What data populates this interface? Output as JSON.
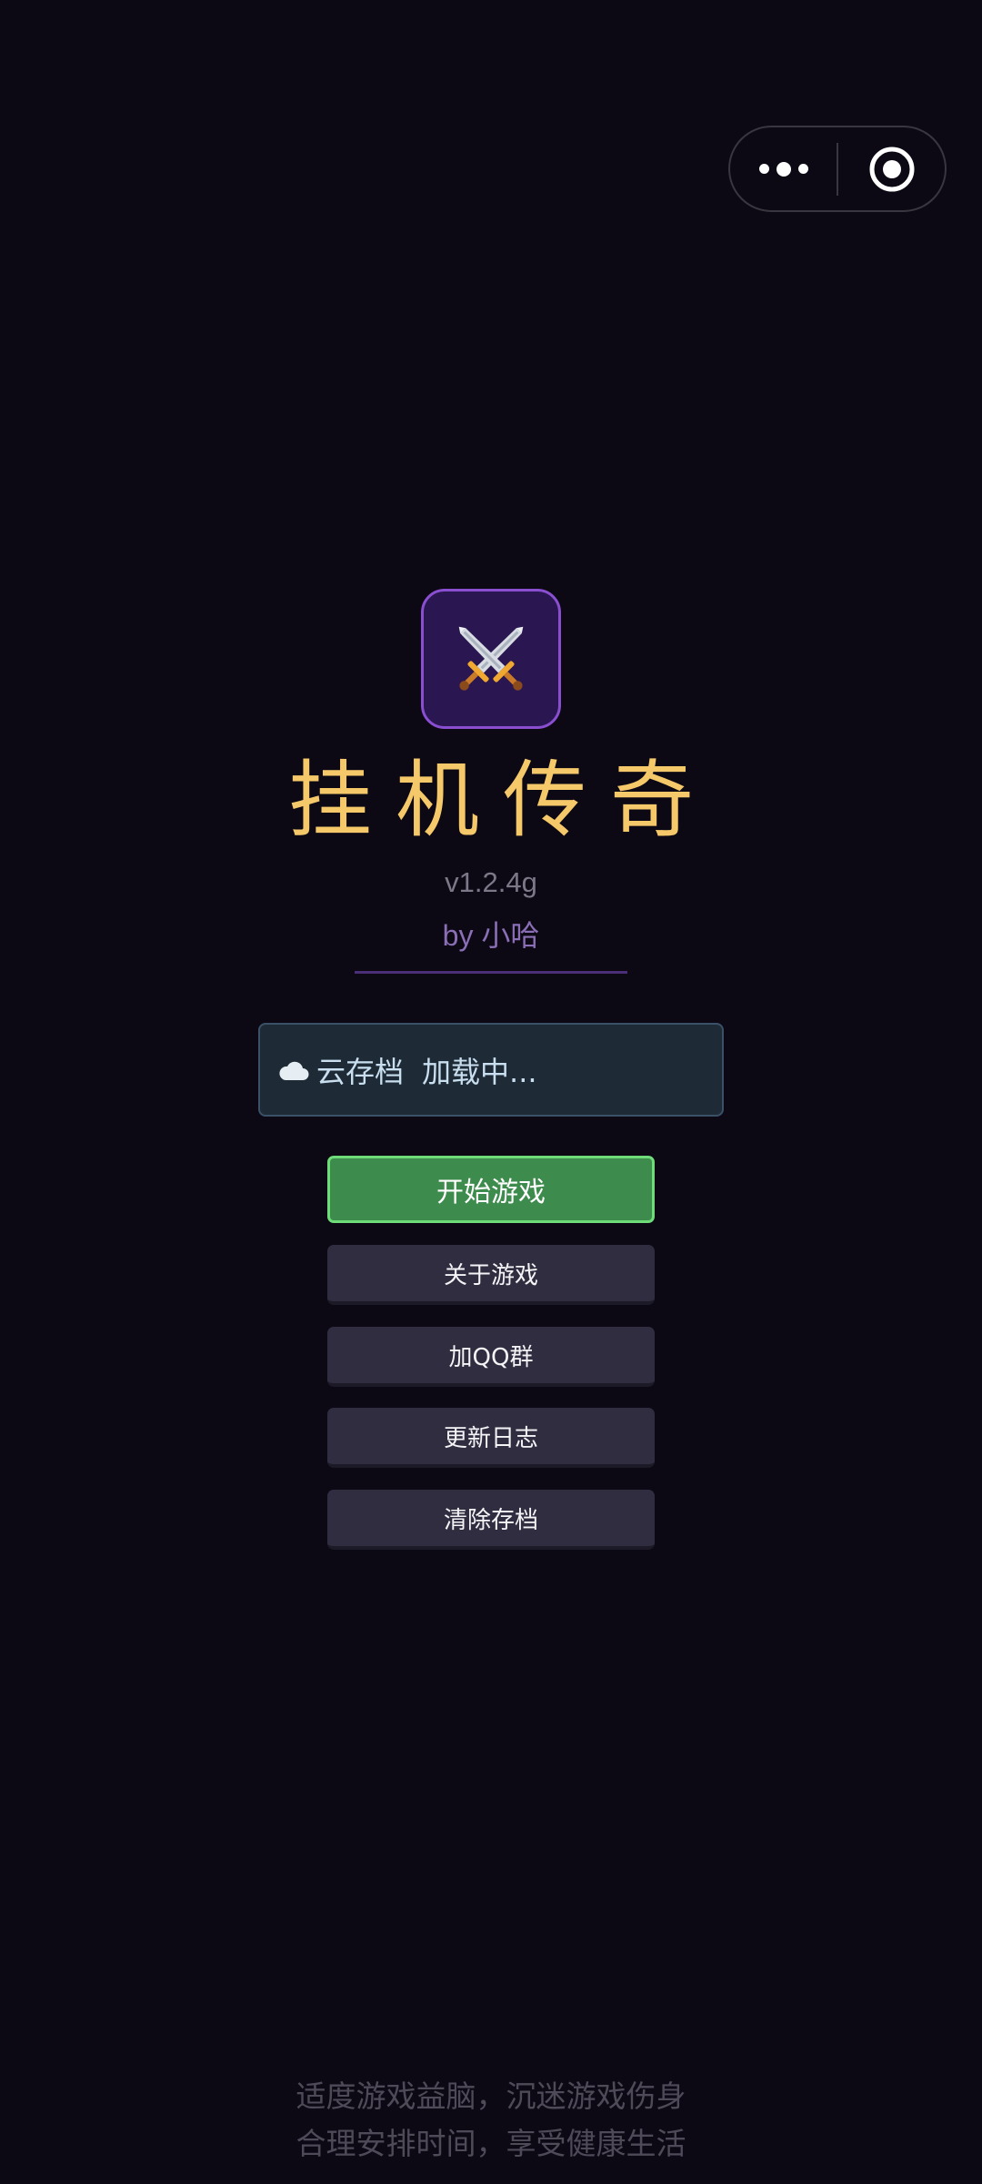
{
  "capsule": {
    "more_icon": "more-dots-icon",
    "close_icon": "target-circle-icon"
  },
  "game": {
    "logo_icon": "crossed-swords-icon",
    "title": "挂机传奇",
    "version": "v1.2.4g",
    "author": "by 小哈"
  },
  "cloud": {
    "icon": "cloud-icon",
    "label": "云存档",
    "status": "加载中..."
  },
  "menu": {
    "start_label": "开始游戏",
    "about_label": "关于游戏",
    "qq_group_label": "加QQ群",
    "changelog_label": "更新日志",
    "clear_save_label": "清除存档"
  },
  "footer": {
    "line1": "适度游戏益脑，沉迷游戏伤身",
    "line2": "合理安排时间，享受健康生活"
  },
  "colors": {
    "background": "#0c0814",
    "title": "#f5c86a",
    "primary_button": "#3e8c4d",
    "secondary_button": "#302d40"
  }
}
